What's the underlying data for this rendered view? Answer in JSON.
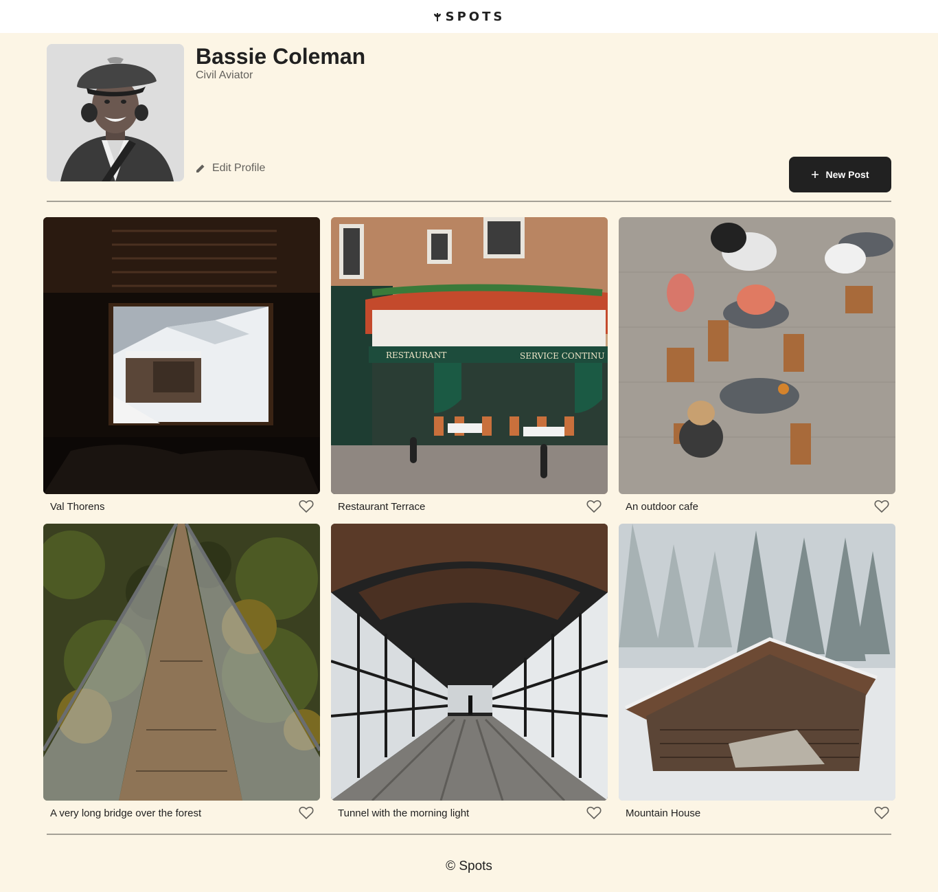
{
  "header": {
    "logo_text": "SPOTS",
    "logo_icon": "spots-plant-icon"
  },
  "profile": {
    "name": "Bassie Coleman",
    "role": "Civil Aviator",
    "edit_label": "Edit Profile",
    "new_post_label": "New Post"
  },
  "cards": [
    {
      "title": "Val Thorens",
      "image": "window-view-snowy-resort"
    },
    {
      "title": "Restaurant Terrace",
      "image": "parisian-restaurant-facade"
    },
    {
      "title": "An outdoor cafe",
      "image": "outdoor-cafe-tables"
    },
    {
      "title": "A very long bridge over the forest",
      "image": "suspension-bridge-forest"
    },
    {
      "title": "Tunnel with the morning light",
      "image": "glass-covered-walkway"
    },
    {
      "title": "Mountain House",
      "image": "wooden-cabin-snow"
    }
  ],
  "footer": {
    "copyright": "© Spots"
  },
  "colors": {
    "background": "#FCF5E5",
    "text": "#212121",
    "button": "#212121",
    "button_text": "#FFFFFF"
  }
}
